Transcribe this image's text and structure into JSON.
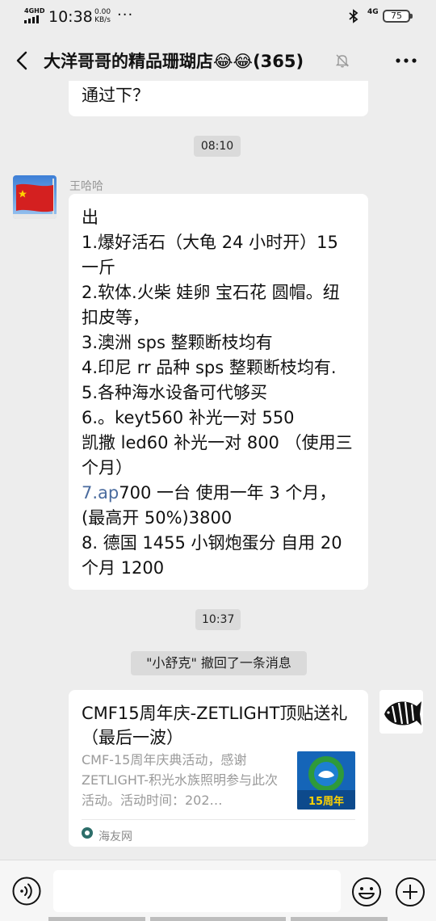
{
  "status_bar": {
    "network_tag": "4GHD",
    "time": "10:38",
    "speed_value": "0.00",
    "speed_unit": "KB/s",
    "more_dots": "···",
    "net_type": "4G",
    "battery_level": "75",
    "icons": [
      "signal-icon",
      "bluetooth-icon",
      "battery-icon"
    ]
  },
  "header": {
    "title": "大洋哥哥的精品珊瑚店😂😂(365)",
    "icons": [
      "back-icon",
      "mute-icon",
      "more-icon"
    ]
  },
  "messages": {
    "previous_tail": "通过下？",
    "time_1": "08:10",
    "sender_name": "王哈哈",
    "main_lines": [
      "出",
      "1.爆好活石（大龟 24 小时开）15",
      "一斤",
      "2.软体.火柴 娃卵 宝石花 圆帽。纽",
      "扣皮等，",
      "3.澳洲 sps 整颗断枝均有",
      "4.印尼 rr 品种 sps 整颗断枝均有.",
      "5.各种海水设备可代够买",
      "6.。keyt560 补光一对 550",
      "凯撒 led60 补光一对 800 （使用三",
      "个月）"
    ],
    "link_fragment": "7.ap",
    "line_7_rest": "700 一台 使用一年 3 个月，",
    "tail_lines": [
      "(最高开 50%)3800",
      "8. 德国 1455 小钢炮蛋分 自用 20",
      "个月 1200"
    ],
    "time_2": "10:37",
    "recall_notice": "\"小舒克\" 撤回了一条消息"
  },
  "link_card": {
    "title": "CMF15周年庆-ZETLIGHT顶贴送礼（最后一波）",
    "description": "CMF-15周年庆典活动，感谢ZETLIGHT-积光水族照明参与此次活动。活动时间：202…",
    "thumb_text": "15周年",
    "source": "海友网"
  },
  "input_bar": {
    "placeholder": "",
    "icons": [
      "voice-icon",
      "emoji-icon",
      "plus-icon"
    ]
  },
  "colors": {
    "background": "#ededed",
    "bubble": "#ffffff",
    "link": "#4a6b9e",
    "muted_text": "#999999"
  }
}
